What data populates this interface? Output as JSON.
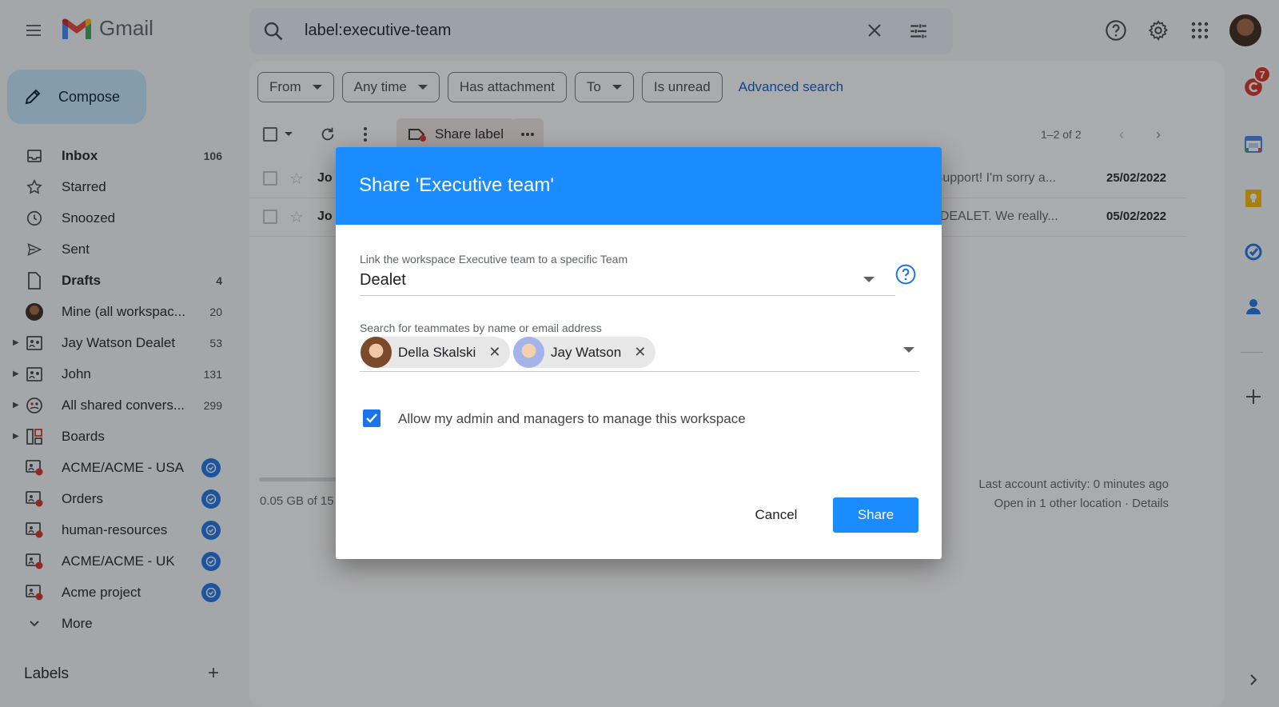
{
  "app": {
    "name": "Gmail"
  },
  "search": {
    "query": "label:executive-team"
  },
  "compose_label": "Compose",
  "nav": [
    {
      "label": "Inbox",
      "count": "106",
      "icon": "inbox-icon",
      "bold": true
    },
    {
      "label": "Starred",
      "count": "",
      "icon": "star-icon"
    },
    {
      "label": "Snoozed",
      "count": "",
      "icon": "clock-icon"
    },
    {
      "label": "Sent",
      "count": "",
      "icon": "send-icon"
    },
    {
      "label": "Drafts",
      "count": "4",
      "icon": "draft-icon",
      "bold": true
    },
    {
      "label": "Mine (all workspac...",
      "count": "20",
      "icon": "avatar-icon"
    },
    {
      "label": "Jay Watson Dealet",
      "count": "53",
      "icon": "shared-label-icon",
      "caret": true
    },
    {
      "label": "John",
      "count": "131",
      "icon": "shared-label-icon",
      "caret": true
    },
    {
      "label": "All shared convers...",
      "count": "299",
      "icon": "shared-conversations-icon",
      "caret": true
    },
    {
      "label": "Boards",
      "count": "",
      "icon": "boards-icon",
      "caret": true
    },
    {
      "label": "ACME/ACME - USA",
      "count": "",
      "icon": "shared-label-red-icon",
      "check": true
    },
    {
      "label": "Orders",
      "count": "",
      "icon": "shared-label-red-icon",
      "check": true
    },
    {
      "label": "human-resources",
      "count": "",
      "icon": "shared-label-red-icon",
      "check": true
    },
    {
      "label": "ACME/ACME - UK",
      "count": "",
      "icon": "shared-label-red-icon",
      "check": true
    },
    {
      "label": "Acme project",
      "count": "",
      "icon": "shared-label-red-icon",
      "check": true
    },
    {
      "label": "More",
      "count": "",
      "icon": "chevron-down-icon"
    }
  ],
  "labels_header": "Labels",
  "filters": {
    "from": "From",
    "any_time": "Any time",
    "has_attachment": "Has attachment",
    "to": "To",
    "is_unread": "Is unread",
    "advanced_search": "Advanced search"
  },
  "toolbar": {
    "share_label": "Share label",
    "pager": "1–2 of 2"
  },
  "emails": [
    {
      "from": "Jo",
      "snippet": "er Support! I'm sorry a...",
      "date": "25/02/2022"
    },
    {
      "from": "Jo",
      "snippet": "ing DEALET. We really...",
      "date": "05/02/2022"
    }
  ],
  "storage": {
    "text": "0.05 GB of 15"
  },
  "activity": {
    "line1": "Last account activity: 0 minutes ago",
    "line2": "Open in 1 other location · Details"
  },
  "rail": {
    "badge_count": "7"
  },
  "dialog": {
    "title": "Share 'Executive team'",
    "team_field_label": "Link the workspace Executive team to a specific Team",
    "team_value": "Dealet",
    "search_label": "Search for teammates by name or email address",
    "teammates": [
      "Della Skalski",
      "Jay Watson"
    ],
    "checkbox_label": "Allow my admin and managers to manage this workspace",
    "checkbox_checked": true,
    "cancel": "Cancel",
    "share": "Share"
  },
  "colors": {
    "accent": "#1a8cff",
    "gmail_red": "#ea4335",
    "badge": "#d93025"
  }
}
